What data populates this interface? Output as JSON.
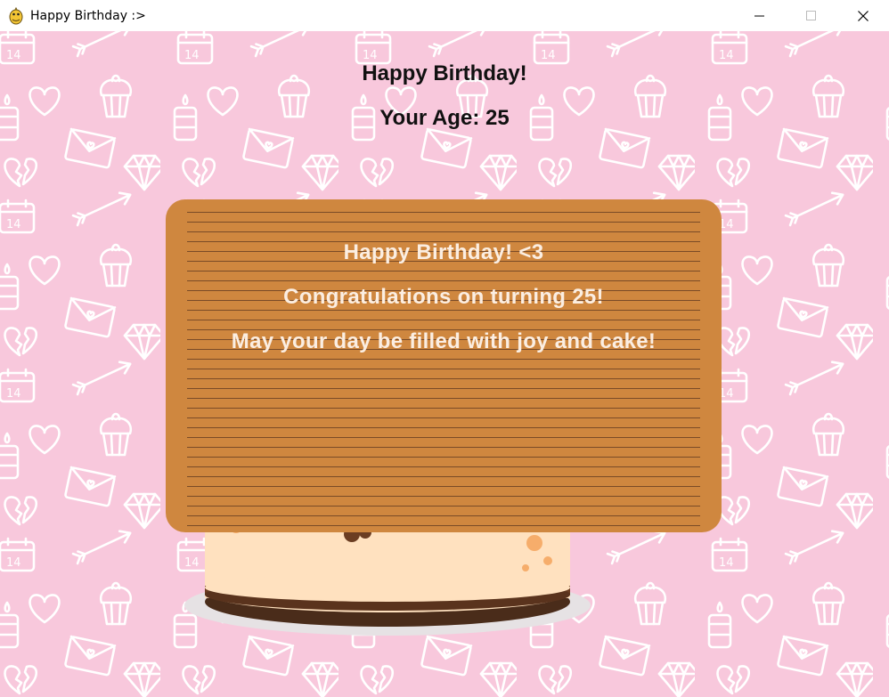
{
  "window": {
    "title": "Happy Birthday :>",
    "controls": {
      "minimize": "minimize",
      "maximize": "maximize",
      "close": "close"
    }
  },
  "header": {
    "title": "Happy Birthday!",
    "age_text": "Your Age: 25"
  },
  "message_board": {
    "line1": "Happy Birthday! <3",
    "line2": "Congratulations on turning 25!",
    "line3": "May your day be filled with joy and cake!"
  },
  "colors": {
    "background": "#f8c8dc",
    "pattern": "#ffffff",
    "board": "#cf873f",
    "board_lines": "#7a4b27",
    "board_text": "#fbeee2"
  },
  "icons": [
    "pygame-snake-icon",
    "minimize-icon",
    "maximize-icon",
    "close-icon"
  ]
}
